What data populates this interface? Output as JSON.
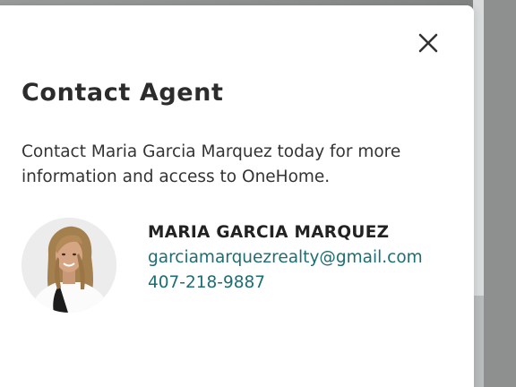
{
  "dialog": {
    "title": "Contact Agent",
    "description": "Contact Maria Garcia Marquez today for more information and access to OneHome.",
    "close_icon": "close-icon"
  },
  "agent": {
    "name": "MARIA GARCIA MARQUEZ",
    "email": "garciamarquezrealty@gmail.com",
    "phone": "407-218-9887",
    "photo_icon": "agent-photo"
  },
  "colors": {
    "link": "#1d6d74",
    "title": "#2c2c2c",
    "text": "#333333",
    "overlay": "#8f9191"
  }
}
